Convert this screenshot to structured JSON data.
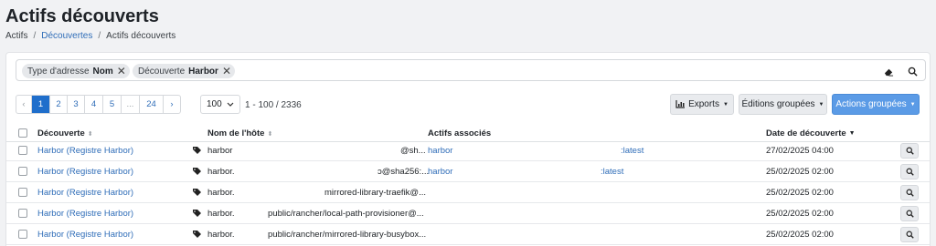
{
  "page": {
    "title": "Actifs découverts"
  },
  "breadcrumb": {
    "root": "Actifs",
    "sep": "/",
    "parent": "Découvertes",
    "current": "Actifs découverts"
  },
  "filters": [
    {
      "field": "Type d'adresse",
      "value": "Nom"
    },
    {
      "field": "Découverte",
      "value": "Harbor"
    }
  ],
  "pagination": {
    "prev": "‹",
    "pages": [
      "1",
      "2",
      "3",
      "4",
      "5",
      "...",
      "24"
    ],
    "next": "›",
    "active": "1",
    "per_page": "100",
    "range": "1 - 100 / 2336"
  },
  "toolbar": {
    "exports": "Exports",
    "group_edit": "Éditions groupées",
    "group_actions": "Actions groupées"
  },
  "table": {
    "columns": {
      "discovery": "Découverte",
      "hostname": "Nom de l'hôte",
      "assets": "Actifs associés",
      "date": "Date de découverte"
    },
    "rows": [
      {
        "discovery": "Harbor (Registre Harbor)",
        "host": "harbor",
        "path": "@sh...",
        "asset": "harbor",
        "tag": ":latest",
        "date": "27/02/2025 04:00"
      },
      {
        "discovery": "Harbor (Registre Harbor)",
        "host": "harbor.",
        "path": "ɔ@sha256:...",
        "asset": "harbor",
        "tag": ":latest",
        "date": "25/02/2025 02:00"
      },
      {
        "discovery": "Harbor (Registre Harbor)",
        "host": "harbor.",
        "path": "mirrored-library-traefik@...",
        "asset": "",
        "tag": "",
        "date": "25/02/2025 02:00"
      },
      {
        "discovery": "Harbor (Registre Harbor)",
        "host": "harbor.",
        "path": "public/rancher/local-path-provisioner@...",
        "asset": "",
        "tag": "",
        "date": "25/02/2025 02:00"
      },
      {
        "discovery": "Harbor (Registre Harbor)",
        "host": "harbor.",
        "path": "public/rancher/mirrored-library-busybox...",
        "asset": "",
        "tag": "",
        "date": "25/02/2025 02:00"
      }
    ]
  }
}
